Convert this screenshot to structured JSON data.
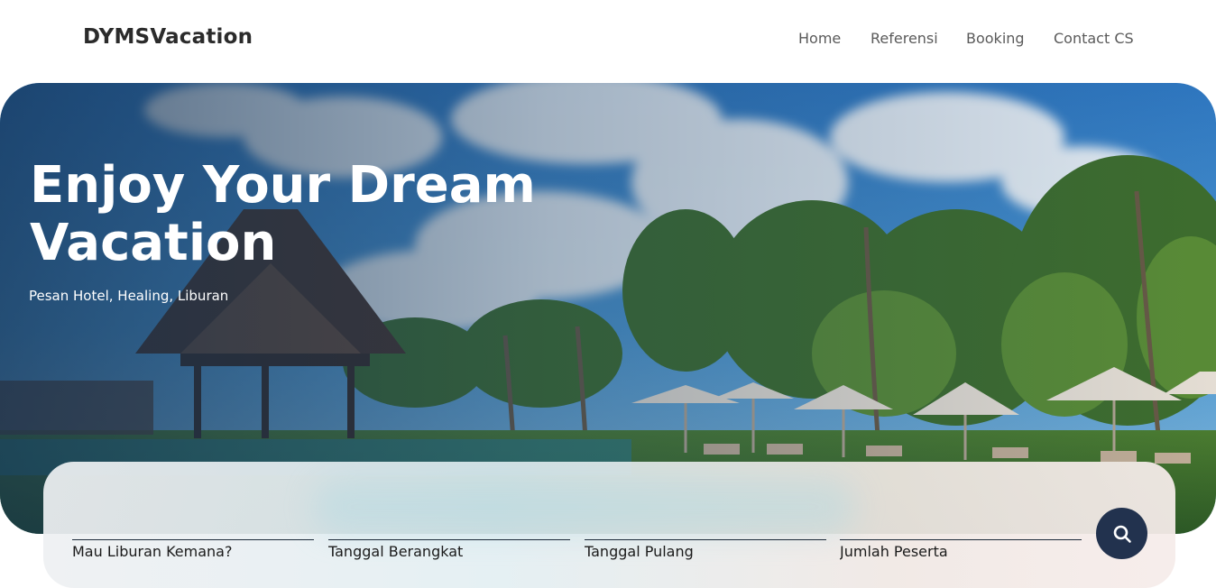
{
  "brand": {
    "name": "DYMSVacation"
  },
  "nav": {
    "items": [
      {
        "label": "Home"
      },
      {
        "label": "Referensi"
      },
      {
        "label": "Booking"
      },
      {
        "label": "Contact CS"
      }
    ]
  },
  "hero": {
    "title": "Enjoy Your Dream Vacation",
    "subtitle": "Pesan Hotel, Healing, Liburan",
    "image": "tropical resort with palm trees, pavilion and umbrellas"
  },
  "search": {
    "fields": [
      {
        "placeholder": "Mau Liburan Kemana?",
        "value": ""
      },
      {
        "placeholder": "Tanggal Berangkat",
        "value": ""
      },
      {
        "placeholder": "Tanggal Pulang",
        "value": ""
      },
      {
        "placeholder": "Jumlah Peserta",
        "value": ""
      }
    ],
    "button_icon": "search-icon"
  },
  "colors": {
    "brand_text": "#2b2b2b",
    "nav_text": "#5a5a5a",
    "hero_overlay": "#1e3a5f",
    "search_button": "#22324e"
  }
}
